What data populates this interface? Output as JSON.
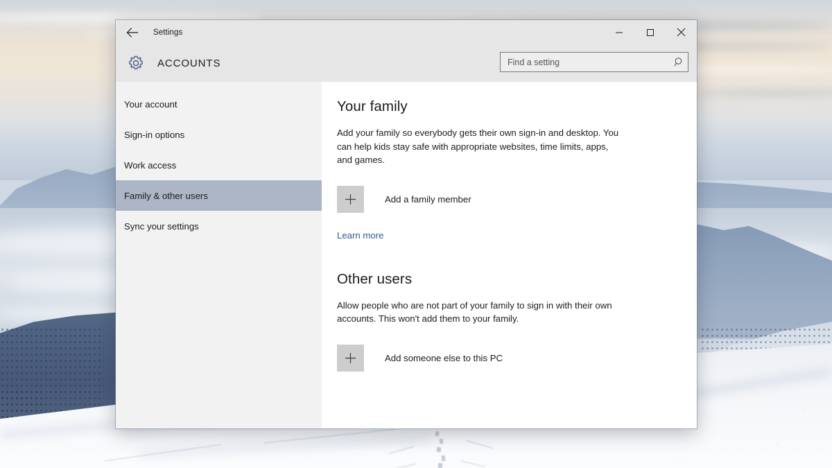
{
  "window": {
    "app_title": "Settings",
    "page_title": "ACCOUNTS",
    "back_icon": "back-arrow-icon",
    "gear_icon": "gear-icon",
    "controls": {
      "minimize": "minimize-icon",
      "maximize": "maximize-icon",
      "close": "close-icon"
    }
  },
  "search": {
    "placeholder": "Find a setting",
    "value": "",
    "icon": "search-icon"
  },
  "sidebar": {
    "items": [
      {
        "label": "Your account",
        "selected": false
      },
      {
        "label": "Sign-in options",
        "selected": false
      },
      {
        "label": "Work access",
        "selected": false
      },
      {
        "label": "Family & other users",
        "selected": true
      },
      {
        "label": "Sync your settings",
        "selected": false
      }
    ]
  },
  "main": {
    "family": {
      "heading": "Your family",
      "description": "Add your family so everybody gets their own sign-in and desktop. You can help kids stay safe with appropriate websites, time limits, apps, and games.",
      "add_button_label": "Add a family member",
      "add_button_icon": "plus-icon",
      "learn_more": "Learn more"
    },
    "other_users": {
      "heading": "Other users",
      "description": "Allow people who are not part of your family to sign in with their own accounts. This won't add them to your family.",
      "add_button_label": "Add someone else to this PC",
      "add_button_icon": "plus-icon"
    }
  },
  "colors": {
    "accent_link": "#2c5a94",
    "selection": "#adb6c7",
    "chrome": "#e6e6e6",
    "sidebar": "#f2f2f2",
    "gear": "#4a5d84"
  }
}
